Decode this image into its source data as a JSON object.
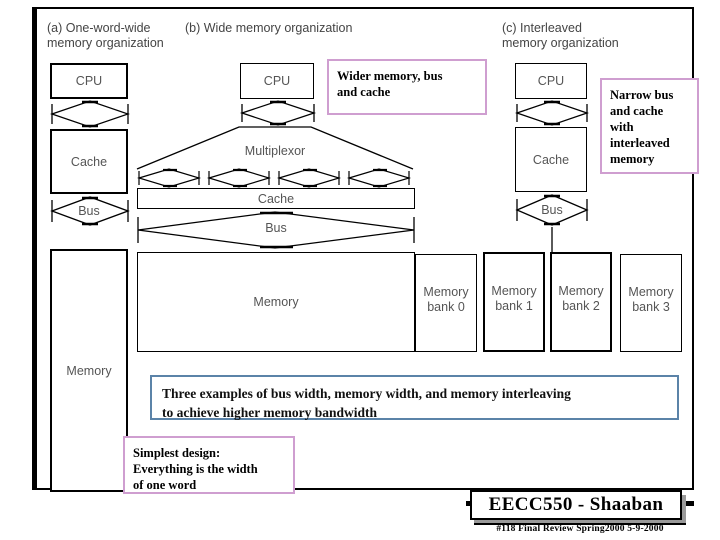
{
  "slide": {
    "columns": [
      {
        "id": "a",
        "caption": "(a) One-word-wide\n      memory organization"
      },
      {
        "id": "b",
        "caption": "(b) Wide memory organization"
      },
      {
        "id": "c",
        "caption": "(c) Interleaved\n      memory organization"
      }
    ],
    "col_a": {
      "cpu": "CPU",
      "cache": "Cache",
      "bus": "Bus",
      "memory": "Memory"
    },
    "col_b": {
      "cpu": "CPU",
      "multiplexor": "Multiplexor",
      "cache": "Cache",
      "bus": "Bus",
      "memory": "Memory"
    },
    "col_c": {
      "cpu": "CPU",
      "cache": "Cache",
      "bus": "Bus",
      "banks": [
        "Memory\nbank 0",
        "Memory\nbank 1",
        "Memory\nbank 2",
        "Memory\nbank 3"
      ]
    },
    "annotations": {
      "wide": "Wider memory,  bus\nand cache",
      "narrow": "Narrow bus\nand cache\nwith\ninterleaved\nmemory",
      "summary": "Three examples of bus width, memory width, and memory interleaving\nto achieve higher memory bandwidth",
      "simplest": "Simplest design:\nEverything is the width\nof one word"
    }
  },
  "footer": {
    "title": "EECC550 - Shaaban",
    "subtitle": "#118   Final Review    Spring2000   5-9-2000"
  },
  "colors": {
    "pink_border": "#cf9ed0",
    "blue_border": "#5b83a8",
    "box_text": "#555555",
    "caption_text": "#444444"
  }
}
